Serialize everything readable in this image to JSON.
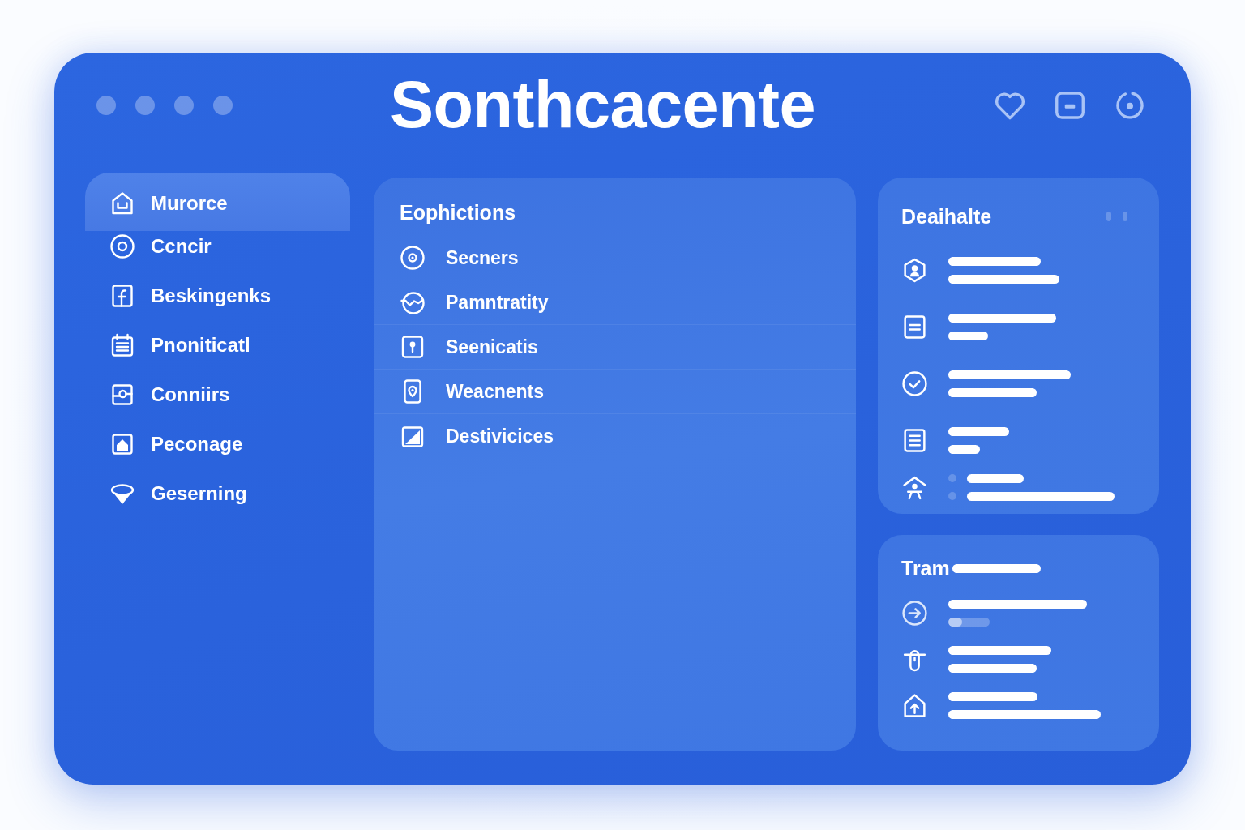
{
  "window": {
    "title": "Sonthcacente"
  },
  "sidebar": {
    "items": [
      {
        "label": "Murorce",
        "selected": true
      },
      {
        "label": "Ccncir",
        "selected": false
      },
      {
        "label": "Beskingenks",
        "selected": false
      },
      {
        "label": "Pnoniticatl",
        "selected": false
      },
      {
        "label": "Conniirs",
        "selected": false
      },
      {
        "label": "Peconage",
        "selected": false
      },
      {
        "label": "Geserning",
        "selected": false
      }
    ]
  },
  "main_panel": {
    "title": "Eophictions",
    "items": [
      {
        "label": "Secners"
      },
      {
        "label": "Pamntratity"
      },
      {
        "label": "Seenicatis"
      },
      {
        "label": "Weacnents"
      },
      {
        "label": "Destivicices"
      }
    ]
  },
  "details_panel": {
    "title": "Deaihalte"
  },
  "transfer_panel": {
    "title": "Tram",
    "progress": {
      "level": 0.33
    }
  }
}
